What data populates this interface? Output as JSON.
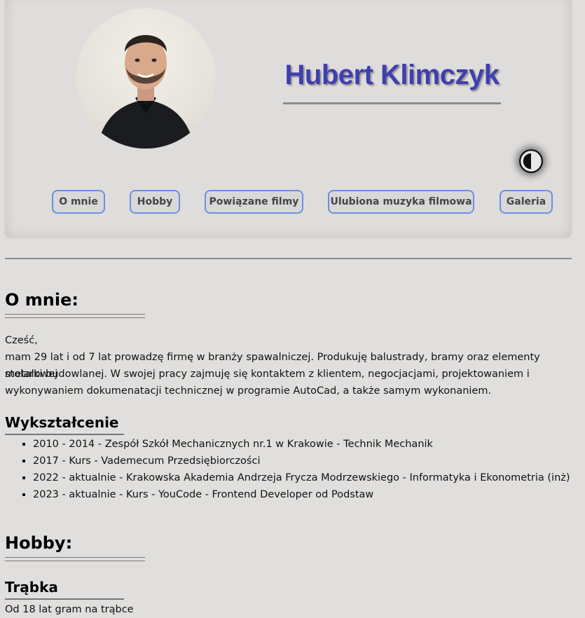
{
  "header": {
    "name": "Hubert Klimczyk",
    "avatar_icon": "profile-photo"
  },
  "nav": {
    "items": [
      {
        "label": "O mnie"
      },
      {
        "label": "Hobby"
      },
      {
        "label": "Powiązane filmy"
      },
      {
        "label": "Ulubiona muzyka filmowa"
      },
      {
        "label": "Galeria"
      }
    ]
  },
  "theme_toggle": {
    "icon": "contrast-icon"
  },
  "about": {
    "title": "O mnie:",
    "greeting": "Cześć,",
    "body_line1": "mam 29 lat i od 7 lat prowadzę firmę w branży spawalniczej. Produkuję balustrady, bramy oraz elementy metalowej",
    "body_line2": "stolarki budowlanej. W swojej pracy zajmuję się kontaktem z klientem, negocjacjami, projektowaniem i",
    "body_line3": "wykonywaniem dokumenatacji technicznej w programie AutoCad, a także samym wykonaniem."
  },
  "education": {
    "title": "Wykształcenie",
    "items": [
      "2010 - 2014 - Zespół Szkół Mechanicznych nr.1 w Krakowie - Technik Mechanik",
      "2017 - Kurs - Vademecum Przedsiębiorczości",
      "2022 - aktualnie - Krakowska Akademia Andrzeja Frycza Modrzewskiego - Informatyka i Ekonometria (inż)",
      "2023 - aktualnie - Kurs - YouCode - Frontend Developer od Podstaw"
    ]
  },
  "hobby": {
    "title": "Hobby:",
    "trumpet_title": "Trąbka",
    "trumpet_text": "Od 18 lat gram na trąbce"
  },
  "colors": {
    "background": "#e1dfdd",
    "name_color": "#3f3fb0",
    "nav_border": "#6b8fe0"
  }
}
